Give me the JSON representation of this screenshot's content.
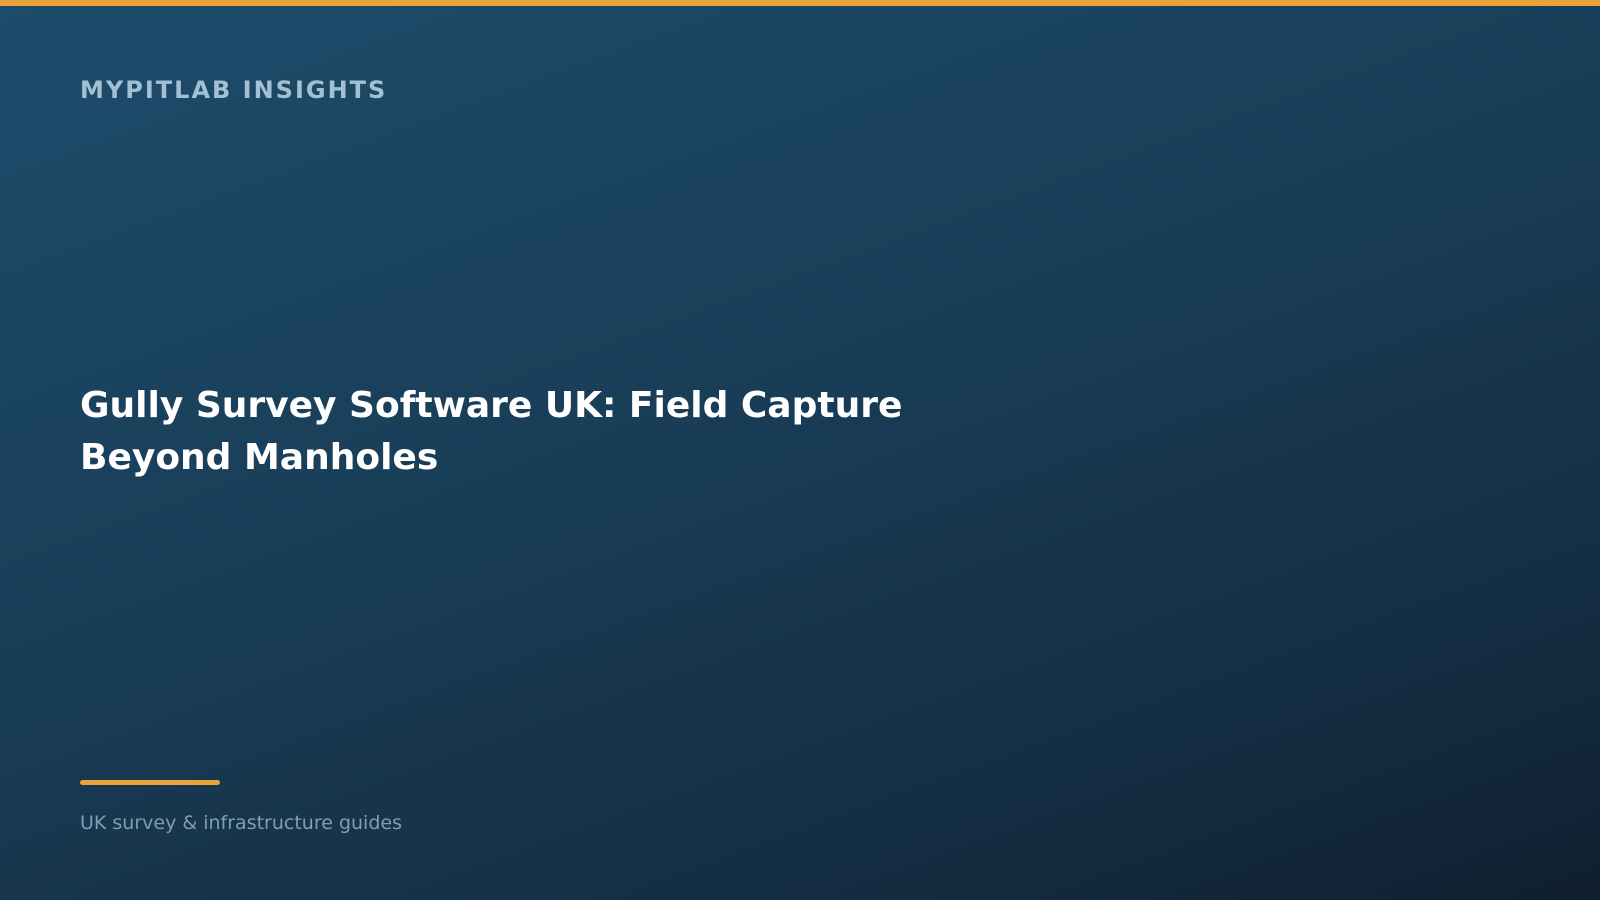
{
  "brand": {
    "label": "MYPITLAB INSIGHTS"
  },
  "hero": {
    "title": "Gully Survey Software UK: Field Capture Beyond Manholes",
    "tagline": "UK survey & infrastructure guides"
  },
  "colors": {
    "accent": "#e8a43a",
    "background_top": "#1d4d6c",
    "background_bottom": "#101f2f",
    "brand_text": "#a3bfd3",
    "title_text": "#ffffff",
    "tagline_text": "#7f9db3"
  }
}
